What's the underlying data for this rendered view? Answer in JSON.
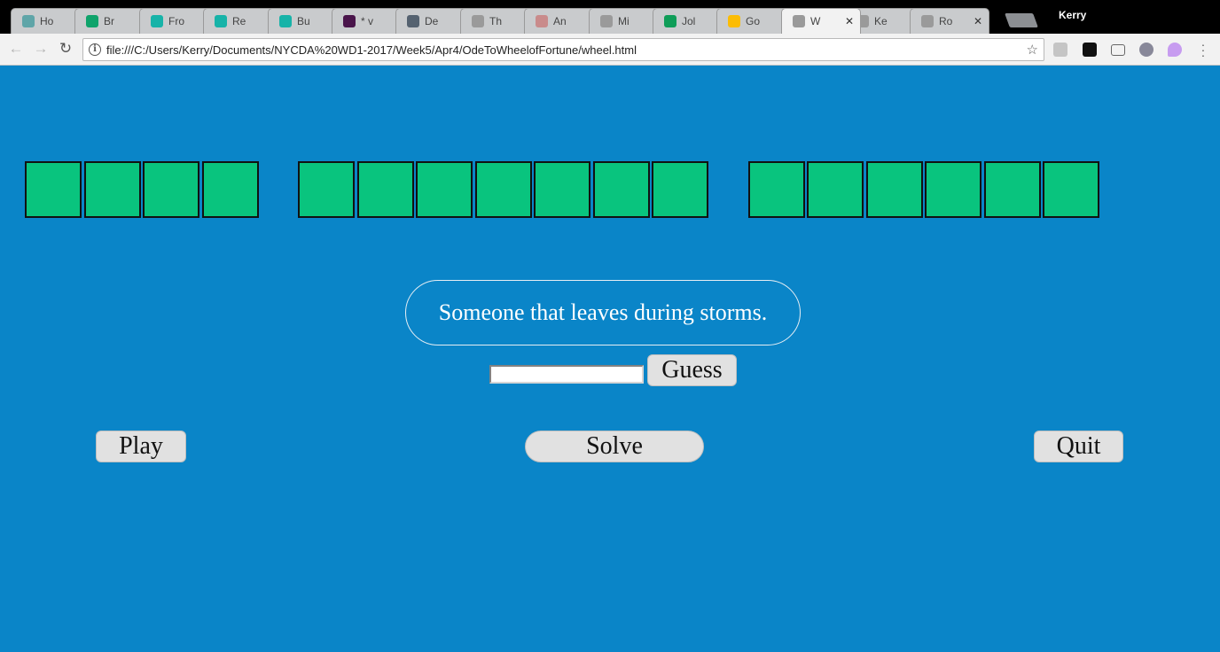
{
  "browser": {
    "tabs": [
      {
        "title": "Ho",
        "icon": "ladder-icon",
        "color": "#5fa5a8"
      },
      {
        "title": "Br",
        "icon": "drop-icon",
        "color": "#0fa36b"
      },
      {
        "title": "Fro",
        "icon": "c-icon",
        "color": "#17b3a8"
      },
      {
        "title": "Re",
        "icon": "c-icon",
        "color": "#17b3a8"
      },
      {
        "title": "Bu",
        "icon": "c-icon",
        "color": "#17b3a8"
      },
      {
        "title": "* v",
        "icon": "slack-icon",
        "color": "#4a154b"
      },
      {
        "title": "De",
        "icon": "o-icon",
        "color": "#556270"
      },
      {
        "title": "Th",
        "icon": "page-icon",
        "color": "#9a9a9a"
      },
      {
        "title": "An",
        "icon": "code-icon",
        "color": "#c98b8b"
      },
      {
        "title": "Mi",
        "icon": "page-icon",
        "color": "#9a9a9a"
      },
      {
        "title": "Jol",
        "icon": "sheets-icon",
        "color": "#0f9d58"
      },
      {
        "title": "Go",
        "icon": "drive-icon",
        "color": "#fbbc05"
      },
      {
        "title": "W",
        "icon": "page-icon",
        "color": "#9a9a9a",
        "active": true
      },
      {
        "title": "Ke",
        "icon": "page-icon",
        "color": "#9a9a9a"
      },
      {
        "title": "Ro",
        "icon": "page-icon",
        "color": "#9a9a9a"
      }
    ],
    "close_glyph": "✕",
    "profile_name": "Kerry",
    "url": "file:///C:/Users/Kerry/Documents/NYCDA%20WD1-2017/Week5/Apr4/OdeToWheelofFortune/wheel.html",
    "nav": {
      "back": "←",
      "forward": "→",
      "reload": "↻",
      "info": "i",
      "star": "☆"
    }
  },
  "game": {
    "words": [
      4,
      7,
      6
    ],
    "tile_color": "#09c47e",
    "background_color": "#0a85c8",
    "clue": "Someone that leaves during storms.",
    "guess_input_value": "",
    "guess_button": "Guess",
    "play_button": "Play",
    "solve_button": "Solve",
    "quit_button": "Quit"
  }
}
